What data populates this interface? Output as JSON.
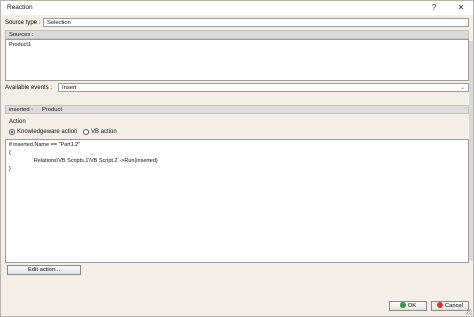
{
  "window": {
    "title": "Reaction",
    "help": "?",
    "close": "✕"
  },
  "source_type": {
    "label": "Source type :",
    "value": "Selection"
  },
  "sources": {
    "label": "Sources :",
    "items": [
      "Product1"
    ]
  },
  "available_events": {
    "label": "Available events :",
    "value": "Insert"
  },
  "event_binding": {
    "label": "inserted :",
    "value": "Product"
  },
  "action": {
    "label": "Action",
    "options": [
      {
        "label": "Knowledgeware action",
        "checked": true
      },
      {
        "label": "VB action",
        "checked": false
      }
    ],
    "code_lines": [
      "if inserted.Name == \"Part1.2\"",
      "{",
      "               `Relations\\VB Scripts.1\\VB Script.2`->Run(inserted)",
      "}"
    ]
  },
  "buttons": {
    "edit_action": "Edit action...",
    "ok": "OK",
    "cancel": "Cancel"
  },
  "colors": {
    "dialog_bg": "#f3efe7",
    "ok_icon": "#2e9d3a",
    "cancel_icon": "#d33a2c"
  }
}
